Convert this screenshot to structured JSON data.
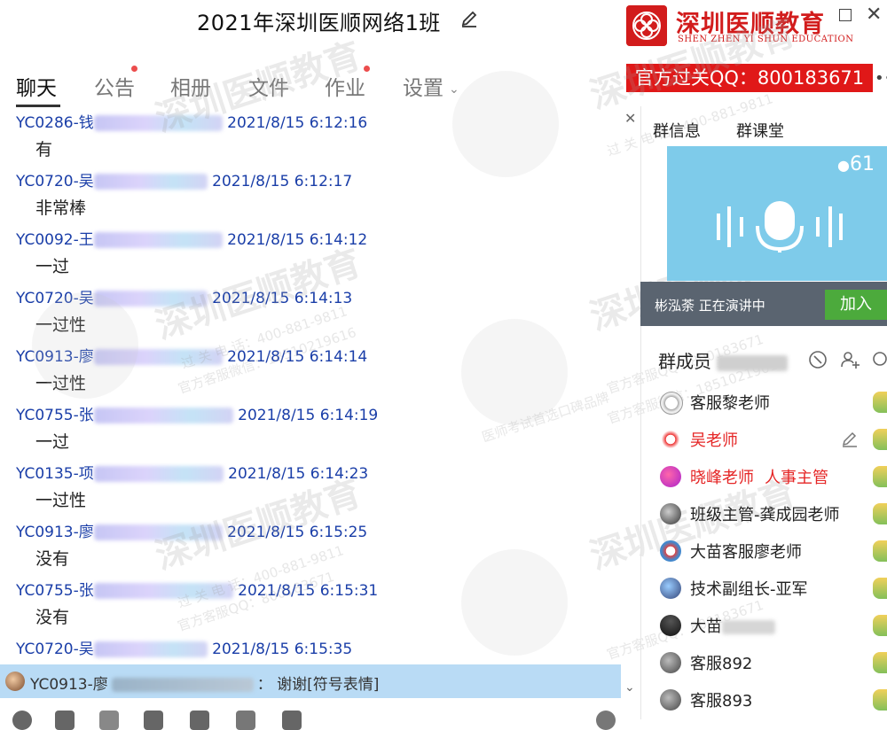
{
  "window": {
    "title": "2021年深圳医顺网络1班"
  },
  "brand": {
    "name": "深圳医顺教育",
    "subtitle": "SHEN ZHEN YI SHUN EDUCATION",
    "qq_banner": "官方过关QQ：800183671",
    "color": "#d21c1c"
  },
  "tabs": [
    {
      "label": "聊天",
      "active": true,
      "dot": false
    },
    {
      "label": "公告",
      "active": false,
      "dot": true
    },
    {
      "label": "相册",
      "active": false,
      "dot": false
    },
    {
      "label": "文件",
      "active": false,
      "dot": false
    },
    {
      "label": "作业",
      "active": false,
      "dot": true
    },
    {
      "label": "设置",
      "active": false,
      "dot": false
    }
  ],
  "messages": [
    {
      "sender": "YC0286-钱",
      "time": "2021/8/15 6:12:16",
      "text": "有"
    },
    {
      "sender": "YC0720-吴",
      "time": "2021/8/15 6:12:17",
      "text": "非常棒"
    },
    {
      "sender": "YC0092-王",
      "time": "2021/8/15 6:14:12",
      "text": "一过"
    },
    {
      "sender": "YC0720-吴",
      "time": "2021/8/15 6:14:13",
      "text": "一过性"
    },
    {
      "sender": "YC0913-廖",
      "time": "2021/8/15 6:14:14",
      "text": "一过性"
    },
    {
      "sender": "YC0755-张",
      "time": "2021/8/15 6:14:19",
      "text": "一过"
    },
    {
      "sender": "YC0135-项",
      "time": "2021/8/15 6:14:23",
      "text": "一过性"
    },
    {
      "sender": "YC0913-廖",
      "time": "2021/8/15 6:15:25",
      "text": "没有"
    },
    {
      "sender": "YC0755-张",
      "time": "2021/8/15 6:15:31",
      "text": "没有"
    },
    {
      "sender": "YC0720-吴",
      "time": "2021/8/15 6:15:35",
      "text": ""
    }
  ],
  "bottom_notice": {
    "sender": "YC0913-廖",
    "separator": "：",
    "text": "谢谢[符号表情]"
  },
  "side_panel": {
    "tabs": [
      "群信息",
      "群课堂"
    ],
    "voice_count": "61",
    "speaking_text": "彬泓荼 正在演讲中",
    "join_label": "加入",
    "members_label": "群成员",
    "members": [
      {
        "name": "客服黎老师",
        "red": false,
        "role": ""
      },
      {
        "name": "吴老师",
        "red": true,
        "role": ""
      },
      {
        "name": "晓峰老师",
        "red": true,
        "role": "人事主管"
      },
      {
        "name": "班级主管-龚成园老师",
        "red": false,
        "role": ""
      },
      {
        "name": "大苗客服廖老师",
        "red": false,
        "role": ""
      },
      {
        "name": "技术副组长-亚军",
        "red": false,
        "role": ""
      },
      {
        "name": "大苗",
        "red": false,
        "role": ""
      },
      {
        "name": "客服892",
        "red": false,
        "role": ""
      },
      {
        "name": "客服893",
        "red": false,
        "role": ""
      }
    ]
  },
  "watermark": {
    "main": "深圳医顺教育",
    "phone": "过 关 电 话：400-881-9811",
    "qq": "官方客服QQ：800183671",
    "wechat": "官方客服微信：18510219616",
    "slogan": "医师考试首选口碑品牌"
  }
}
